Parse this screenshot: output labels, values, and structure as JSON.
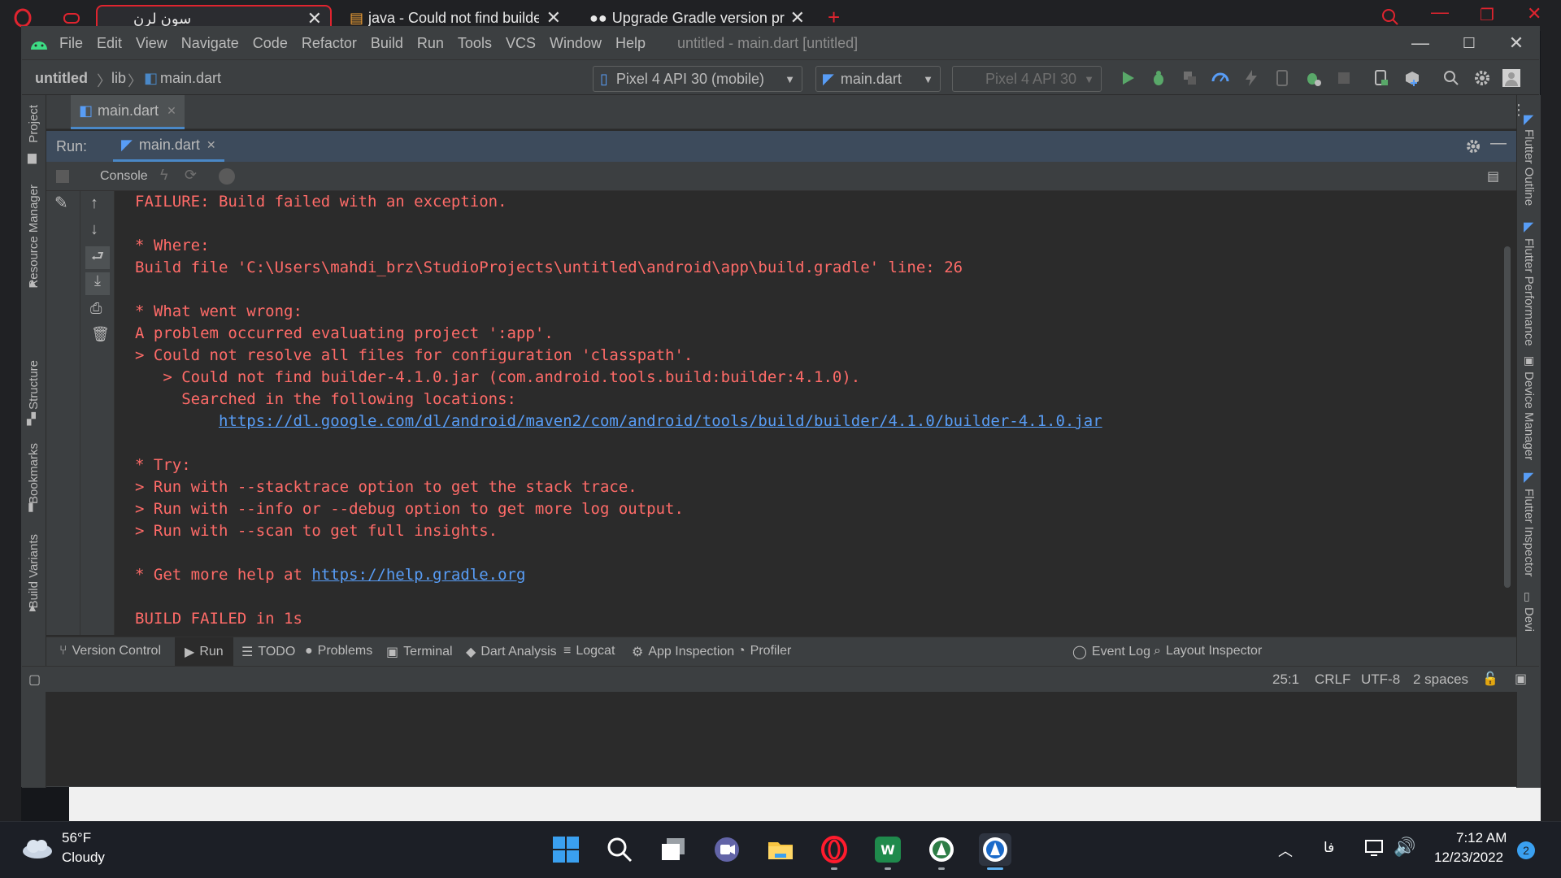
{
  "browser": {
    "tabs": [
      {
        "title": "سون لرن",
        "active": true
      },
      {
        "title": "java - Could not find builde",
        "active": false
      },
      {
        "title": "Upgrade Gradle version pr",
        "active": false
      }
    ],
    "new_tab": "+"
  },
  "menubar": {
    "items": [
      "File",
      "Edit",
      "View",
      "Navigate",
      "Code",
      "Refactor",
      "Build",
      "Run",
      "Tools",
      "VCS",
      "Window",
      "Help"
    ],
    "title": "untitled - main.dart [untitled]"
  },
  "navbar": {
    "breadcrumb": [
      "untitled",
      "lib",
      "main.dart"
    ],
    "device": "Pixel 4 API 30 (mobile)",
    "run_config": "main.dart",
    "device_disabled": "Pixel 4 API 30"
  },
  "left_strip": {
    "labels": [
      "Project",
      "Resource Manager",
      "Structure",
      "Bookmarks",
      "Build Variants"
    ]
  },
  "right_strip": {
    "labels": [
      "Flutter Outline",
      "Flutter Performance",
      "Device Manager",
      "Flutter Inspector",
      "Devi"
    ]
  },
  "editor": {
    "tab": "main.dart"
  },
  "run": {
    "label": "Run:",
    "tab": "main.dart",
    "console_tab": "Console"
  },
  "console": {
    "lines": [
      {
        "text": "FAILURE: Build failed with an exception."
      },
      {
        "text": ""
      },
      {
        "text": "* Where:"
      },
      {
        "text": "Build file 'C:\\Users\\mahdi_brz\\StudioProjects\\untitled\\android\\app\\build.gradle' line: 26"
      },
      {
        "text": ""
      },
      {
        "text": "* What went wrong:"
      },
      {
        "text": "A problem occurred evaluating project ':app'."
      },
      {
        "text": "> Could not resolve all files for configuration 'classpath'."
      },
      {
        "text": "   > Could not find builder-4.1.0.jar (com.android.tools.build:builder:4.1.0)."
      },
      {
        "text": "     Searched in the following locations:"
      },
      {
        "text": "         ",
        "link": "https://dl.google.com/dl/android/maven2/com/android/tools/build/builder/4.1.0/builder-4.1.0.jar"
      },
      {
        "text": ""
      },
      {
        "text": "* Try:"
      },
      {
        "text": "> Run with --stacktrace option to get the stack trace."
      },
      {
        "text": "> Run with --info or --debug option to get more log output."
      },
      {
        "text": "> Run with --scan to get full insights."
      },
      {
        "text": ""
      },
      {
        "text": "* Get more help at ",
        "link": "https://help.gradle.org"
      },
      {
        "text": ""
      },
      {
        "text": "BUILD FAILED in 1s"
      }
    ]
  },
  "tool_tabs": {
    "left": [
      "Version Control",
      "Run",
      "TODO",
      "Problems",
      "Terminal",
      "Dart Analysis",
      "Logcat",
      "App Inspection",
      "Profiler"
    ],
    "right": [
      "Event Log",
      "Layout Inspector"
    ]
  },
  "status": {
    "position": "25:1",
    "line_sep": "CRLF",
    "encoding": "UTF-8",
    "indent": "2 spaces"
  },
  "taskbar": {
    "weather_temp": "56°F",
    "weather_desc": "Cloudy",
    "lang": "فا",
    "time": "7:12 AM",
    "date": "12/23/2022",
    "notifications": "2"
  },
  "colors": {
    "error_text": "#ff6b68",
    "link": "#589df6",
    "run_green": "#59a869",
    "accent": "#4a88c7"
  }
}
